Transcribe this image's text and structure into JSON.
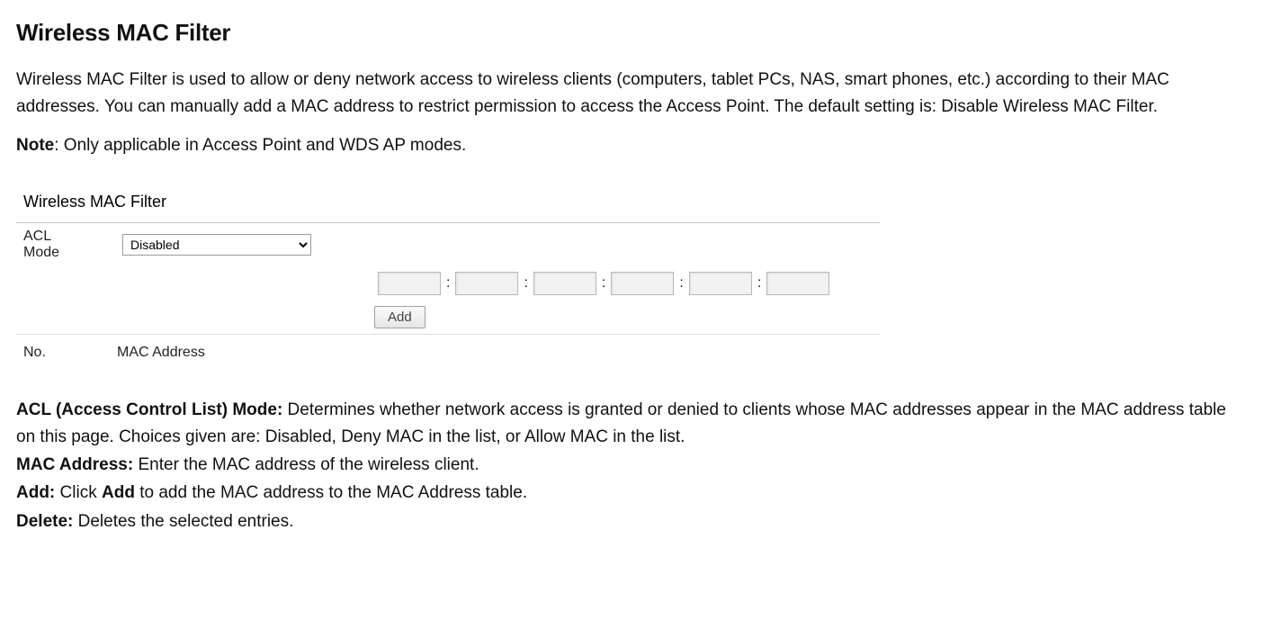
{
  "page": {
    "title": "Wireless MAC Filter",
    "intro": "Wireless MAC Filter is used to allow or deny network access to wireless clients (computers, tablet PCs, NAS, smart phones, etc.) according to their MAC addresses. You can manually add a MAC address to restrict permission to access the Access Point. The default setting is: Disable Wireless MAC Filter.",
    "note_label": "Note",
    "note_text": ": Only applicable in Access Point and WDS AP modes."
  },
  "panel": {
    "title": "Wireless MAC Filter",
    "acl_label_line1": "ACL",
    "acl_label_line2": "Mode",
    "acl_selected": "Disabled",
    "mac_inputs": [
      "",
      "",
      "",
      "",
      "",
      ""
    ],
    "colon": ":",
    "add_button": "Add",
    "col_no": "No.",
    "col_mac": "MAC Address"
  },
  "descriptions": {
    "acl_label": "ACL (Access Control List) Mode:",
    "acl_text": " Determines whether network access is granted or denied to clients whose MAC addresses appear in the MAC address table on this page. Choices given are: Disabled, Deny MAC in the list, or Allow MAC in the list.",
    "mac_label": "MAC Address:",
    "mac_text": " Enter the MAC address of the wireless client.",
    "add_label": "Add:",
    "add_text_pre": " Click ",
    "add_bold": "Add",
    "add_text_post": " to add the MAC address to the MAC Address table.",
    "del_label": "Delete:",
    "del_text": " Deletes the selected entries."
  }
}
